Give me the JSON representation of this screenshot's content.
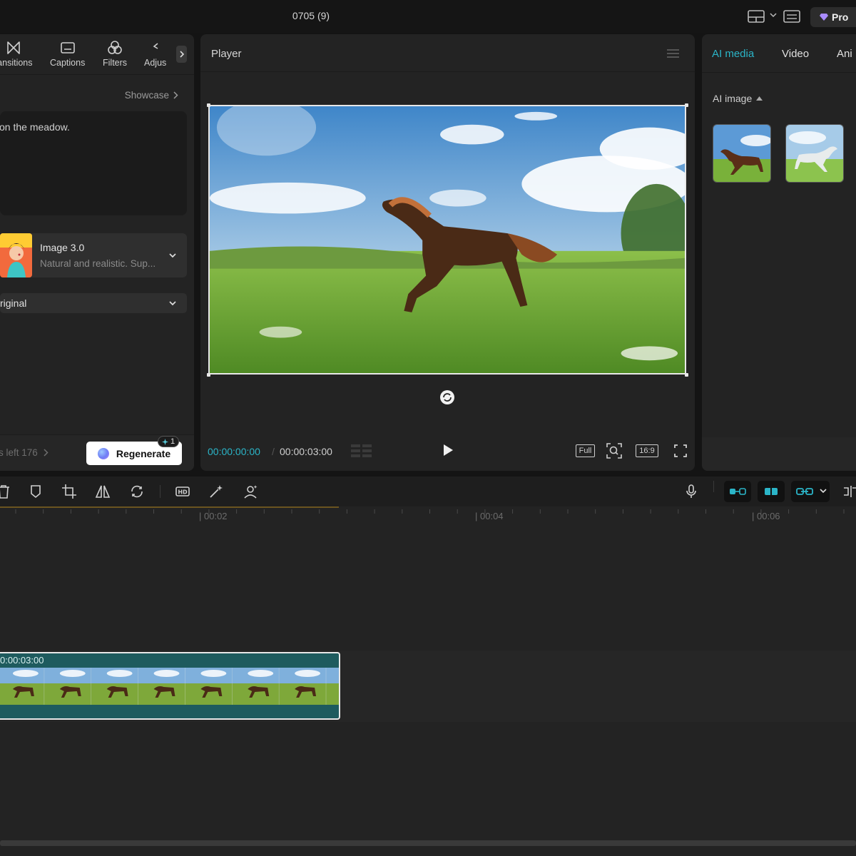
{
  "window": {
    "title": "0705 (9)"
  },
  "topbar": {
    "pro_label": "Pro"
  },
  "toolbar": {
    "tools": [
      "ransitions",
      "Captions",
      "Filters",
      "Adjus"
    ]
  },
  "generator": {
    "showcase_label": "Showcase",
    "prompt_text": "on the meadow.",
    "model_name": "Image 3.0",
    "model_desc": "Natural and realistic. Sup...",
    "ratio_value": "riginal",
    "credits_text": "s left 176",
    "regenerate_label": "Regenerate",
    "regenerate_badge": "1"
  },
  "player": {
    "title": "Player",
    "current_time": "00:00:00:00",
    "separator": "/",
    "total_time": "00:00:03:00",
    "full_label": "Full",
    "ratio_label": "16:9"
  },
  "media": {
    "tabs": [
      "AI media",
      "Video",
      "Ani"
    ],
    "active_tab": "AI media",
    "section_label": "AI image"
  },
  "timeline": {
    "ruler_labels": [
      "00:02",
      "00:04",
      "00:06"
    ],
    "clip_duration": "0:00:03:00"
  },
  "colors": {
    "accent": "#2bb5c8",
    "clip": "#1e5b5e"
  }
}
